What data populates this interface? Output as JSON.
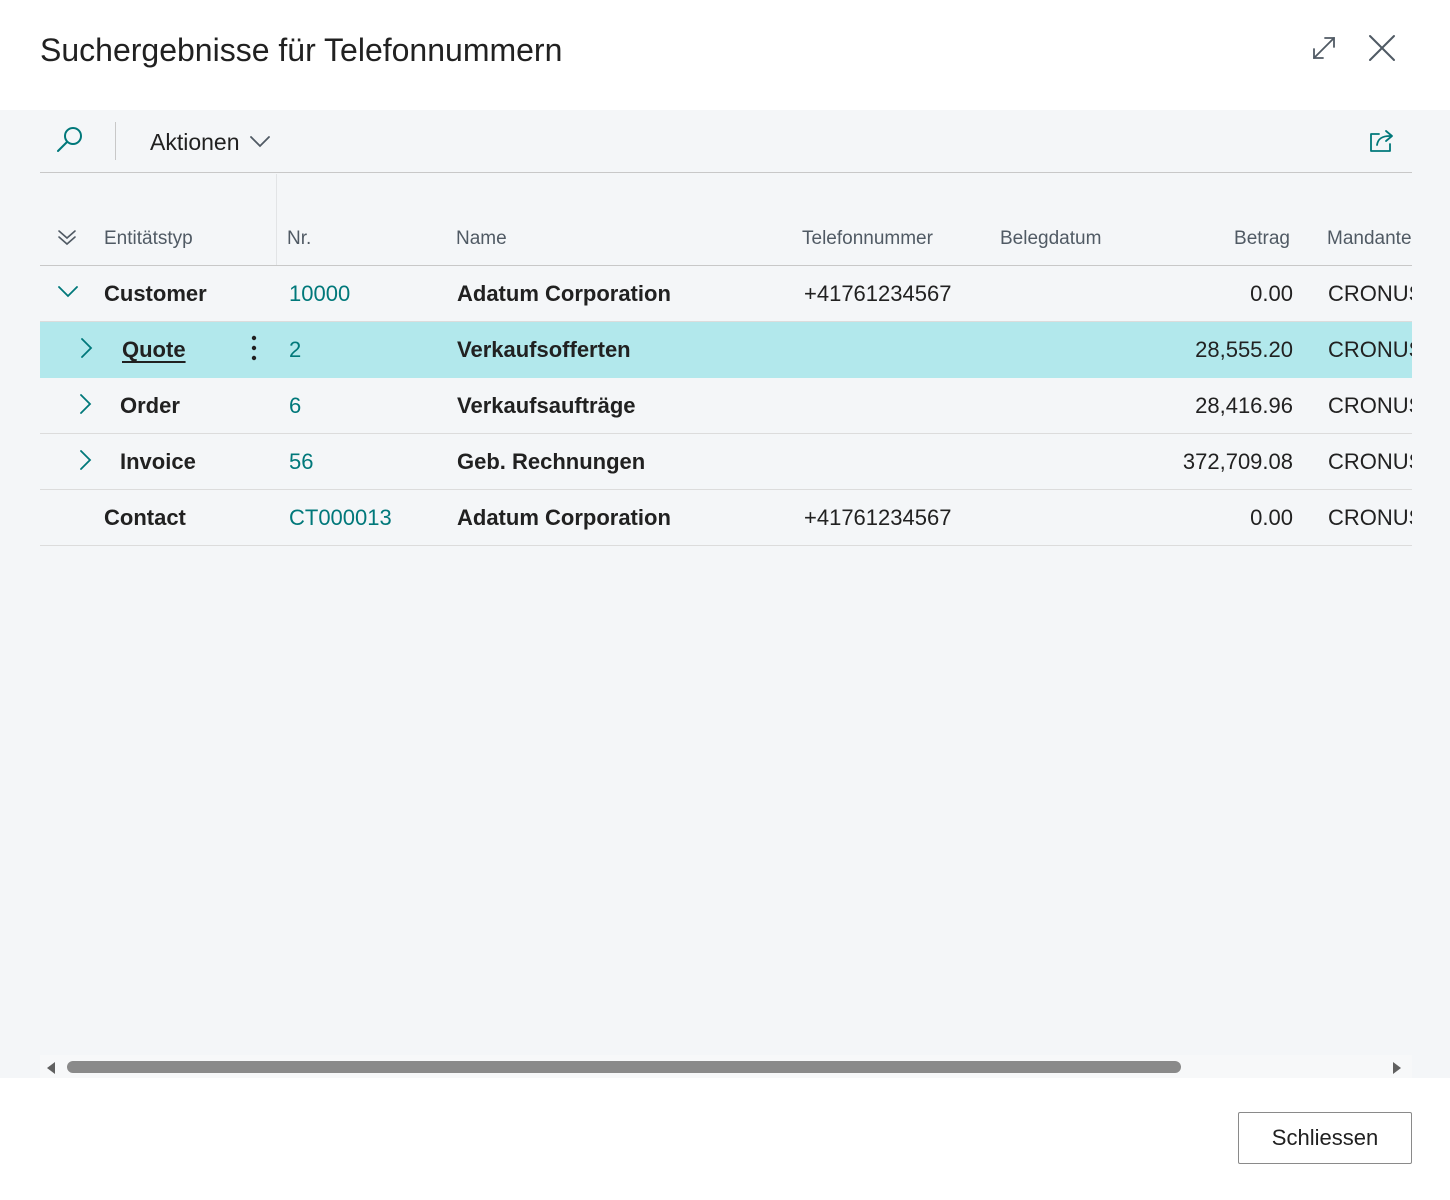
{
  "dialog": {
    "title": "Suchergebnisse für Telefonnummern",
    "expand_icon": "expand-diagonal-icon",
    "close_icon": "close-x-icon"
  },
  "actionbar": {
    "search_icon": "search-icon",
    "actions_label": "Aktionen",
    "share_icon": "share-icon"
  },
  "grid": {
    "columns": {
      "entity_type": "Entitätstyp",
      "no": "Nr.",
      "name": "Name",
      "phone": "Telefonnummer",
      "doc_date": "Belegdatum",
      "amount": "Betrag",
      "company": "Mandantenname"
    },
    "rows": [
      {
        "entity_type": "Customer",
        "no": "10000",
        "name": "Adatum Corporation",
        "phone": "+41761234567",
        "doc_date": "",
        "amount": "0.00",
        "company": "CRONUS",
        "level": 0,
        "expander": "expanded",
        "selected": false
      },
      {
        "entity_type": "Quote",
        "no": "2",
        "name": "Verkaufsofferten",
        "phone": "",
        "doc_date": "",
        "amount": "28,555.20",
        "company": "CRONUS",
        "level": 1,
        "expander": "collapsed",
        "selected": true
      },
      {
        "entity_type": "Order",
        "no": "6",
        "name": "Verkaufsaufträge",
        "phone": "",
        "doc_date": "",
        "amount": "28,416.96",
        "company": "CRONUS",
        "level": 1,
        "expander": "collapsed",
        "selected": false
      },
      {
        "entity_type": "Invoice",
        "no": "56",
        "name": "Geb. Rechnungen",
        "phone": "",
        "doc_date": "",
        "amount": "372,709.08",
        "company": "CRONUS",
        "level": 1,
        "expander": "collapsed",
        "selected": false
      },
      {
        "entity_type": "Contact",
        "no": "CT000013",
        "name": "Adatum Corporation",
        "phone": "+41761234567",
        "doc_date": "",
        "amount": "0.00",
        "company": "CRONUS",
        "level": 0,
        "expander": "none",
        "selected": false
      }
    ]
  },
  "footer": {
    "close_label": "Schliessen"
  },
  "colors": {
    "accent": "#00787a",
    "selected_row": "#b2e8ec",
    "content_bg": "#f4f6f8"
  }
}
